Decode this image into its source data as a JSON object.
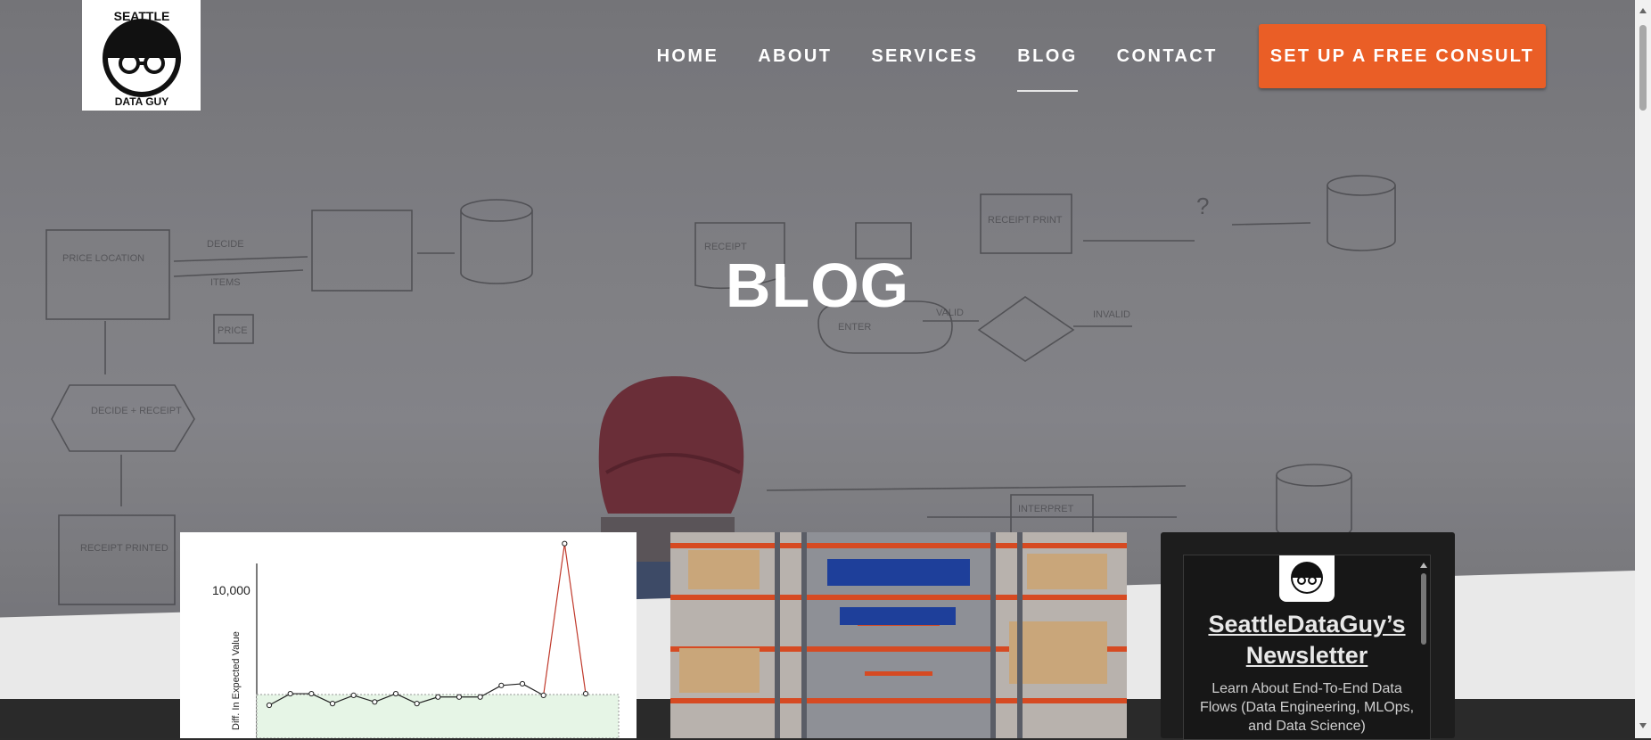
{
  "brand": {
    "logo_top": "SEATTLE",
    "logo_bottom": "DATA GUY"
  },
  "nav": {
    "items": [
      {
        "label": "HOME"
      },
      {
        "label": "ABOUT"
      },
      {
        "label": "SERVICES"
      },
      {
        "label": "BLOG",
        "active": true
      },
      {
        "label": "CONTACT"
      }
    ],
    "cta_label": "SET UP A FREE CONSULT"
  },
  "hero": {
    "title": "BLOG"
  },
  "whiteboard_text": [
    "PRICE LOCATION",
    "DECIDE",
    "ITEMS",
    "PRICE",
    "DECIDE + RECEIPT",
    "RECEIPT PRINTED",
    "RECEIPT",
    "ENTER",
    "VALID",
    "INVALID",
    "RECEIPT PRINT",
    "?",
    "INTERPRET"
  ],
  "blog_cards": [
    {
      "type": "chart",
      "chart": {
        "y_tick": "10,000",
        "y_label": "Diff. In Expected Value",
        "values": [
          0.2,
          0.27,
          0.27,
          0.21,
          0.26,
          0.22,
          0.27,
          0.21,
          0.25,
          0.25,
          0.25,
          0.32,
          0.33,
          0.26,
          1.18,
          0.27
        ]
      }
    },
    {
      "type": "photo",
      "subject": "warehouse shelving"
    }
  ],
  "newsletter": {
    "title": "SeattleDataGuy’s Newsletter",
    "description": "Learn About End-To-End Data Flows (Data Engineering, MLOps, and Data Science)"
  },
  "colors": {
    "accent": "#ea5e26",
    "hero_overlay": "#808084",
    "dark_band": "#2a2a2a"
  }
}
